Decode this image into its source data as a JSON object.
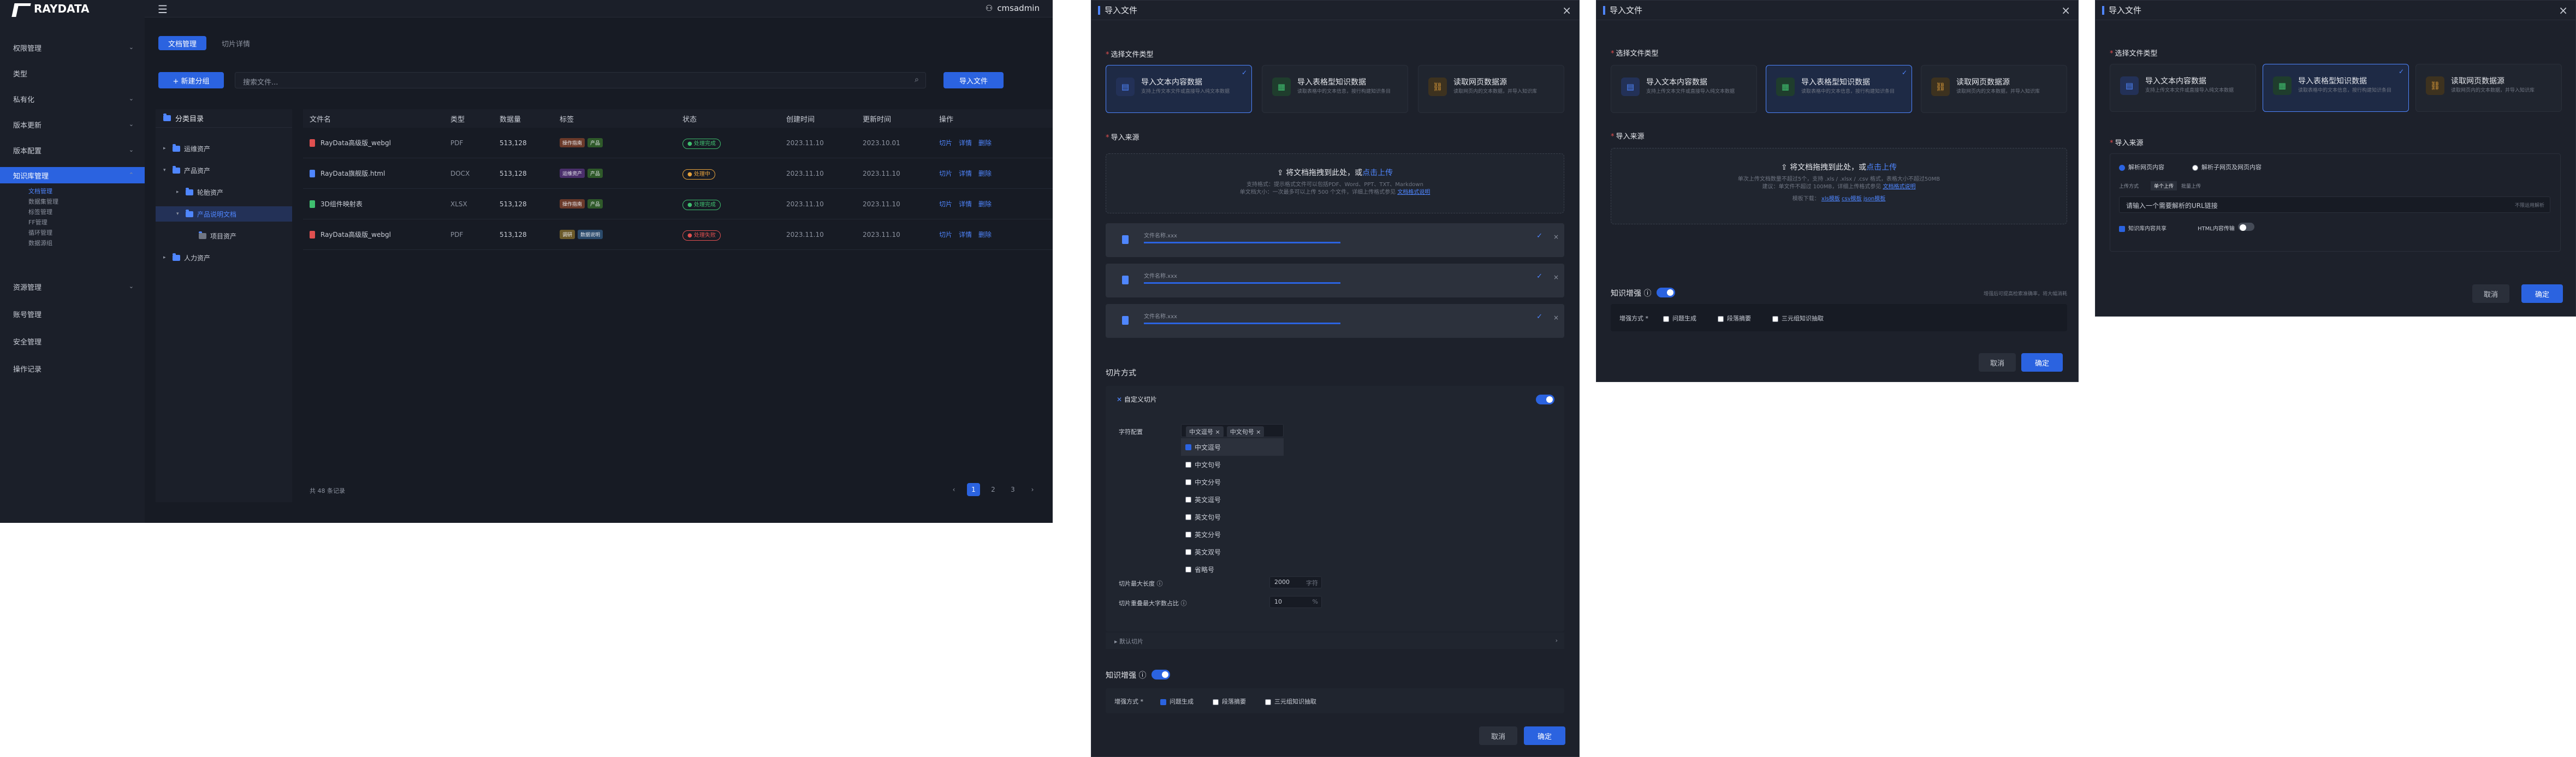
{
  "app": {
    "brand": "RAYDATA",
    "user": "cmsadmin",
    "menu": [
      {
        "label": "权限管理",
        "chev": "⌄"
      },
      {
        "label": "类型",
        "chev": ""
      },
      {
        "label": "私有化",
        "chev": "⌄"
      },
      {
        "label": "版本更新",
        "chev": "⌄"
      },
      {
        "label": "版本配置",
        "chev": "⌄"
      },
      {
        "label": "知识库管理",
        "chev": "⌃"
      }
    ],
    "submenu": [
      "文档管理",
      "数据集管理",
      "标签管理",
      "FF管理",
      "循环管理",
      "数据源组"
    ],
    "menu_after": [
      {
        "label": "资源管理",
        "chev": "⌄"
      },
      {
        "label": "账号管理",
        "chev": ""
      },
      {
        "label": "安全管理",
        "chev": ""
      },
      {
        "label": "操作记录",
        "chev": ""
      }
    ],
    "tabs": [
      "文档管理",
      "切片详情"
    ],
    "new_btn": "+ 新建分组",
    "search_placeholder": "搜索文件...",
    "import_btn": "导入文件",
    "tree_title": "分类目录",
    "tree": [
      {
        "label": "运维资产",
        "arrow": "▸",
        "indent": 0
      },
      {
        "label": "产品资产",
        "arrow": "▾",
        "indent": 0
      },
      {
        "label": "轮胎资产",
        "arrow": "▸",
        "indent": 1
      },
      {
        "label": "产品说明文档",
        "arrow": "▾",
        "indent": 1
      },
      {
        "label": "项目资产",
        "arrow": "",
        "indent": 2
      },
      {
        "label": "人力资产",
        "arrow": "▸",
        "indent": 0
      }
    ],
    "columns": [
      "文件名",
      "类型",
      "数据量",
      "标签",
      "状态",
      "创建时间",
      "更新时间",
      "操作"
    ],
    "rows": [
      {
        "name": "RayData高级版_webgl",
        "type": "PDF",
        "size": "513,128",
        "tags": [
          "操作指南",
          "产品"
        ],
        "tagc": [
          "#6b3a2a",
          "#2f5a2a"
        ],
        "status": "● 处理完成",
        "sc": "#3fbf6f",
        "created": "2023.11.10",
        "updated": "2023.10.01",
        "icon": "#e05050"
      },
      {
        "name": "RayData旗舰版.html",
        "type": "DOCX",
        "size": "513,128",
        "tags": [
          "运维资产",
          "产品"
        ],
        "tagc": [
          "#4a2f6b",
          "#2f5a2a"
        ],
        "status": "● 处理中",
        "sc": "#e6a23c",
        "created": "2023.11.10",
        "updated": "2023.11.10",
        "icon": "#4f86ff"
      },
      {
        "name": "3D组件映射表",
        "type": "XLSX",
        "size": "513,128",
        "tags": [
          "操作指南",
          "产品"
        ],
        "tagc": [
          "#6b3a2a",
          "#2f5a2a"
        ],
        "status": "● 处理完成",
        "sc": "#3fbf6f",
        "created": "2023.11.10",
        "updated": "2023.11.10",
        "icon": "#3fbf6f"
      },
      {
        "name": "RayData高级版_webgl",
        "type": "PDF",
        "size": "513,128",
        "tags": [
          "调研",
          "数据说明"
        ],
        "tagc": [
          "#6b5a2a",
          "#2a4a6b"
        ],
        "status": "● 处理失败",
        "sc": "#e05050",
        "created": "2023.11.10",
        "updated": "2023.11.10",
        "icon": "#e05050"
      }
    ],
    "total": "共 48 条记录",
    "pages": [
      "‹",
      "1",
      "2",
      "3",
      "›"
    ]
  },
  "dialog": {
    "title": "导入文件",
    "sec_type": "选择文件类型",
    "cards": [
      {
        "title": "导入文本内容数据",
        "desc": "支持上传文本文件或直接导入纯文本数据",
        "icon": "▤",
        "color": "#4f86ff",
        "bg": "#233157"
      },
      {
        "title": "导入表格型知识数据",
        "desc": "读取表格中的文本信息，按行构建知识条目",
        "icon": "▦",
        "color": "#3fbf6f",
        "bg": "#1f3d2d"
      },
      {
        "title": "读取网页数据源",
        "desc": "读取网页内的文本数据，并导入知识库",
        "icon": "⛓",
        "color": "#e6a23c",
        "bg": "#3d321f"
      }
    ],
    "sec_source": "导入来源",
    "drop_title": "将文档拖拽到此处，或",
    "drop_link": "点击上传",
    "drop_desc1": "支持格式：提示格式文件可以包括PDF、Word、PPT、TXT、Markdown",
    "drop_desc2": "单文档大小：一次最多可以上传 500 个文件，详细上传格式参见",
    "drop_link2": "文档格式说明",
    "drop2_desc1": "单次上传文档数量不超过5个，支持 .xls / .xlsx / .csv 格式，表格大小不超过50MB",
    "drop2_desc2": "建议：单文件不超过 100MB，详细上传格式参见",
    "drop2_link": "文档格式说明",
    "drop2_tpl": "模板下载：",
    "drop2_tpls": [
      "xls模板",
      "csv模板",
      "json模板"
    ],
    "files": [
      "文件名称.xxx",
      "文件名称.xxx",
      "文件名称.xxx"
    ],
    "slice_title": "切片方式",
    "custom_slice": "自定义切片",
    "sep_label": "字符配置",
    "chips": [
      "中文逗号 ×",
      "中文句号 ×"
    ],
    "sep_opts": [
      {
        "label": "中文逗号",
        "on": true
      },
      {
        "label": "中文句号",
        "on": false
      },
      {
        "label": "中文分号",
        "on": false
      },
      {
        "label": "英文逗号",
        "on": false
      },
      {
        "label": "英文句号",
        "on": false
      },
      {
        "label": "英文分号",
        "on": false
      },
      {
        "label": "英文双号",
        "on": false
      },
      {
        "label": "省略号",
        "on": false
      }
    ],
    "max_len_label": "切片最大长度",
    "max_len": "2000",
    "max_len_unit": "字符",
    "overlap_label": "切片重叠最大字数占比",
    "overlap": "10",
    "overlap_unit": "%",
    "default_slice": "默认切片",
    "enhance_title": "知识增强",
    "enhance_mode": "增强方式",
    "enhance_opts": [
      {
        "label": "问题生成",
        "on": true
      },
      {
        "label": "段落摘要",
        "on": false
      },
      {
        "label": "三元组知识抽取",
        "on": false
      }
    ],
    "enhance_note": "增强后可提高检索准确率，将大幅消耗",
    "cancel": "取消",
    "ok": "确定",
    "web_radio": [
      "解析网页内容",
      "解析子网页及网页内容"
    ],
    "url_tabs": [
      "上传方式",
      "单个上传",
      "批量上传"
    ],
    "url_placeholder": "请输入一个需要解析的URL链接",
    "url_mode": "不限运用解析",
    "url_check": "知识库内容共享",
    "url_toggle": "HTML内容传输"
  }
}
